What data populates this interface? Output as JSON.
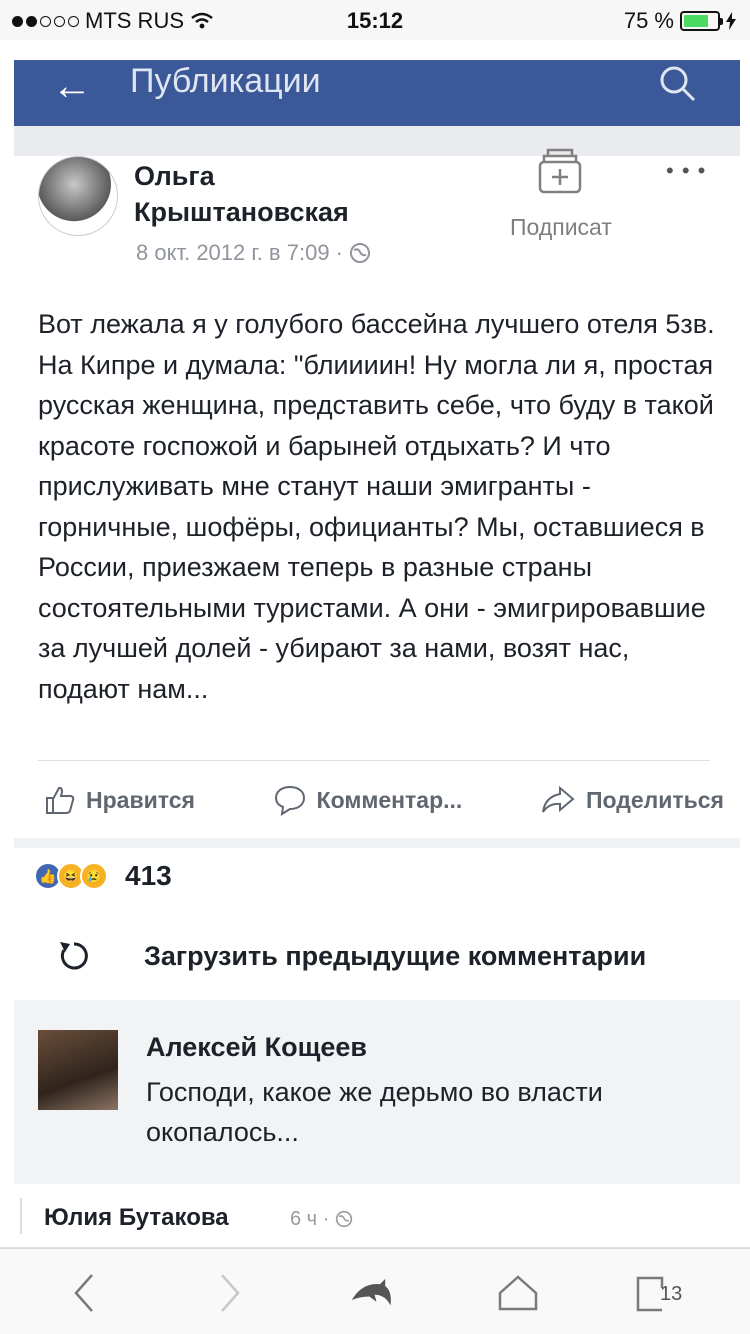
{
  "status_bar": {
    "carrier": "MTS RUS",
    "time": "15:12",
    "battery": "75 %",
    "battery_level": 0.75
  },
  "fb_header": {
    "title": "Публикации",
    "back_icon": "arrow-left-icon",
    "search_icon": "search-icon"
  },
  "post": {
    "author": "Ольга Крыштановская",
    "date": "8 окт. 2012 г. в 7:09 ·",
    "subscribe_label": "Подписат",
    "text": "Вот лежала я у голубого бассейна лучшего отеля 5зв. На Кипре и думала: \"блиииин! Ну могла ли я, простая русская женщина, представить себе, что буду в такой красоте госпожой и барыней отдыхать? И что прислуживать мне станут наши эмигранты - горничные, шофёры, официанты? Мы, оставшиеся в России, приезжаем теперь в разные страны состоятельными туристами. А они - эмигрировавшие за лучшей долей - убирают за нами, возят нас, подают нам..."
  },
  "actions": {
    "like": "Нравится",
    "comment": "Комментар...",
    "share": "Поделиться"
  },
  "reactions": {
    "count": "413",
    "types": [
      "like",
      "haha",
      "sad"
    ]
  },
  "load_more": "Загрузить предыдущие комментарии",
  "comment": {
    "author": "Алексей Кощеев",
    "text": "Господи, какое же дерьмо во власти окопалось..."
  },
  "below_post": {
    "author": "Юлия Бутакова",
    "meta": "6 ч ·"
  },
  "browser_toolbar": {
    "tabs_count": "13"
  }
}
